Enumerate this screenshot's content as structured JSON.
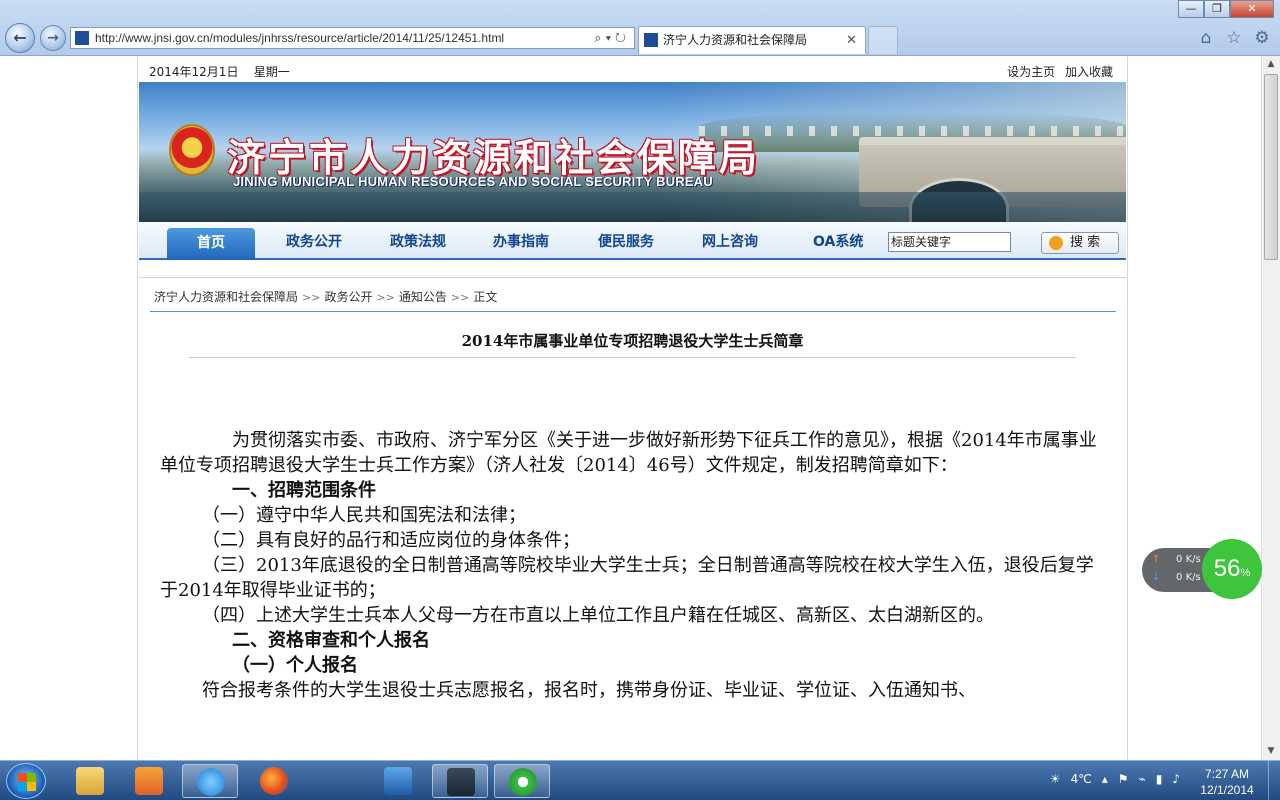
{
  "browser": {
    "url": "http://www.jnsi.gov.cn/modules/jnhrss/resource/article/2014/11/25/12451.html",
    "tab_title": "济宁人力资源和社会保障局",
    "back_icon": "back-arrow-icon",
    "forward_icon": "forward-arrow-icon",
    "window_minimize": "—",
    "window_restore": "❐",
    "window_close": "✕"
  },
  "site": {
    "date": "2014年12月1日",
    "weekday": "星期一",
    "set_home": "设为主页",
    "add_favorite": "加入收藏",
    "title_cn": "济宁市人力资源和社会保障局",
    "title_en": "JINING MUNICIPAL HUMAN RESOURCES AND SOCIAL SECURITY BUREAU",
    "nav": [
      "首页",
      "政务公开",
      "政策法规",
      "办事指南",
      "便民服务",
      "网上咨询",
      "OA系统"
    ],
    "search_placeholder": "标题关键字",
    "search_button": "搜 索"
  },
  "breadcrumb": [
    "济宁人力资源和社会保障局",
    "政务公开",
    "通知公告",
    "正文"
  ],
  "breadcrumb_sep": ">>",
  "article": {
    "title": "2014年市属事业单位专项招聘退役大学生士兵简章",
    "intro": "为贯彻落实市委、市政府、济宁军分区《关于进一步做好新形势下征兵工作的意见》，根据《2014年市属事业单位专项招聘退役大学生士兵工作方案》（济人社发〔2014〕46号）文件规定，制发招聘简章如下：",
    "h1": "一、招聘范围条件",
    "items": [
      "（一）遵守中华人民共和国宪法和法律；",
      "（二）具有良好的品行和适应岗位的身体条件；",
      "（三）2013年底退役的全日制普通高等院校毕业大学生士兵；全日制普通高等院校在校大学生入伍，退役后复学于2014年取得毕业证书的；",
      "（四）上述大学生士兵本人父母一方在市直以上单位工作且户籍在任城区、高新区、太白湖新区的。"
    ],
    "h2": "二、资格审查和个人报名",
    "h2_sub": "（一）个人报名",
    "para2": "符合报考条件的大学生退役士兵志愿报名，报名时，携带身份证、毕业证、学位证、入伍通知书、"
  },
  "widget": {
    "upload": "0",
    "download": "0",
    "unit": "K/s",
    "percent": "56",
    "percent_sign": "%"
  },
  "taskbar": {
    "apps": [
      "file-explorer",
      "media-player",
      "internet-explorer",
      "firefox",
      "search-tool",
      "video-player",
      "green-app"
    ],
    "weather": "4℃",
    "time": "7:27 AM",
    "date": "12/1/2014"
  }
}
